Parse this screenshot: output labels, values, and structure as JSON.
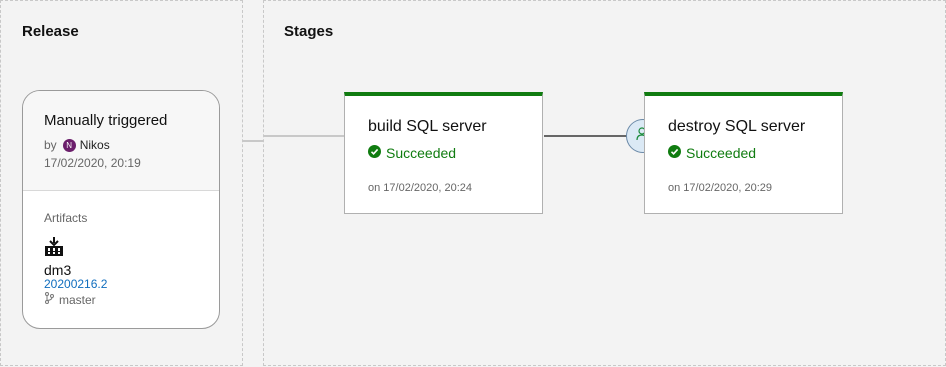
{
  "release_panel": {
    "title": "Release"
  },
  "stages_panel": {
    "title": "Stages"
  },
  "release_card": {
    "title": "Manually triggered",
    "by_prefix": "by",
    "avatar_initial": "N",
    "user": "Nikos",
    "date": "17/02/2020, 20:19",
    "artifacts_label": "Artifacts",
    "artifact": {
      "icon": "build-artifact-icon",
      "name": "dm3",
      "version": "20200216.2",
      "branch_icon": "git-branch-icon",
      "branch": "master"
    }
  },
  "stages": [
    {
      "name": "build SQL server",
      "status": "Succeeded",
      "time": "on 17/02/2020, 20:24"
    },
    {
      "name": "destroy SQL server",
      "status": "Succeeded",
      "time": "on 17/02/2020, 20:29"
    }
  ],
  "colors": {
    "success": "#107c10",
    "link": "#106ebe",
    "avatar": "#6b1e6b"
  },
  "approval_icon": "pre-deployment-approval-icon"
}
